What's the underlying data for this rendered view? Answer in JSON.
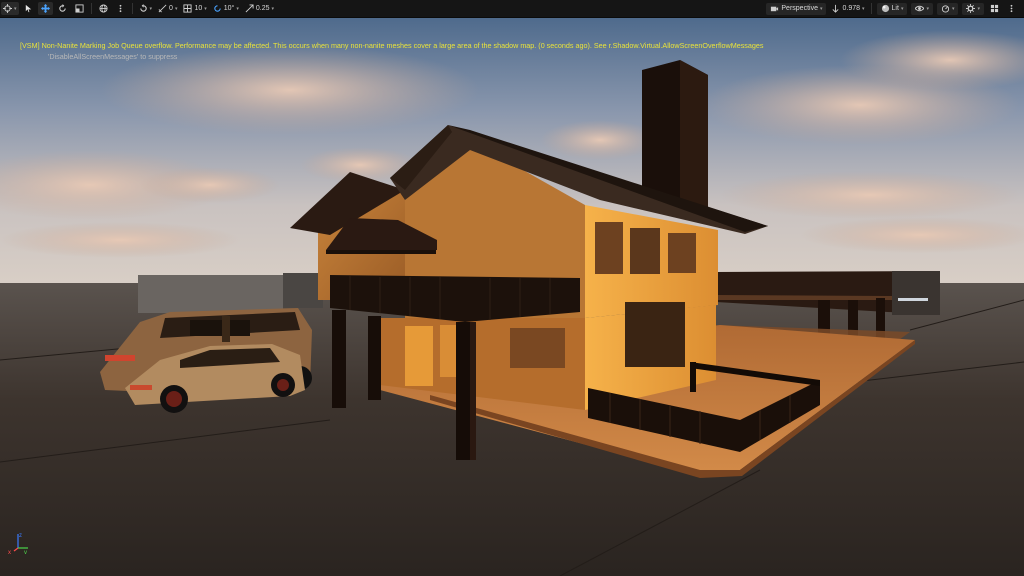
{
  "toolbar": {
    "left": {
      "transform_menu_icon": "transform-mode-icon",
      "select_icon": "select-arrow-icon",
      "translate_icon": "move-arrows-icon",
      "rotate_icon": "rotate-icon",
      "scale_icon": "scale-icon",
      "world_icon": "globe-icon",
      "more_icon": "vertical-dots-icon",
      "surface_snap_icon": "surface-snap-icon",
      "surface_snap_value": "0",
      "grid_snap_value": "10",
      "rotation_snap_value": "10°",
      "scale_snap_value": "0.25",
      "camera_speed_value": ""
    },
    "right": {
      "view_mode_label": "Perspective",
      "camera_speed": "0.978",
      "lit_label": "Lit",
      "show_icon": "eye-icon",
      "performance_icon": "stopwatch-icon",
      "settings_icon": "gear-icon",
      "layout_icon": "viewport-layout-icon"
    }
  },
  "messages": {
    "warning": "[VSM] Non-Nanite Marking Job Queue overflow. Performance may be affected. This occurs when many non-nanite meshes cover a large area of the shadow map. (0 seconds ago). See r.Shadow.Virtual.AllowScreenOverflowMessages",
    "hint": "'DisableAllScreenMessages' to suppress"
  },
  "axis_gizmo": {
    "x_label": "x",
    "z_label": "z",
    "y_label": "y"
  },
  "colors": {
    "warning_text": "#e9e33a",
    "toolbar_bg": "#151515",
    "wood": "#d08a3a",
    "wood_lit": "#f2a83c",
    "dark_timber": "#1c110b",
    "sky_top": "#4f6c8e",
    "floor": "#3a3028"
  }
}
